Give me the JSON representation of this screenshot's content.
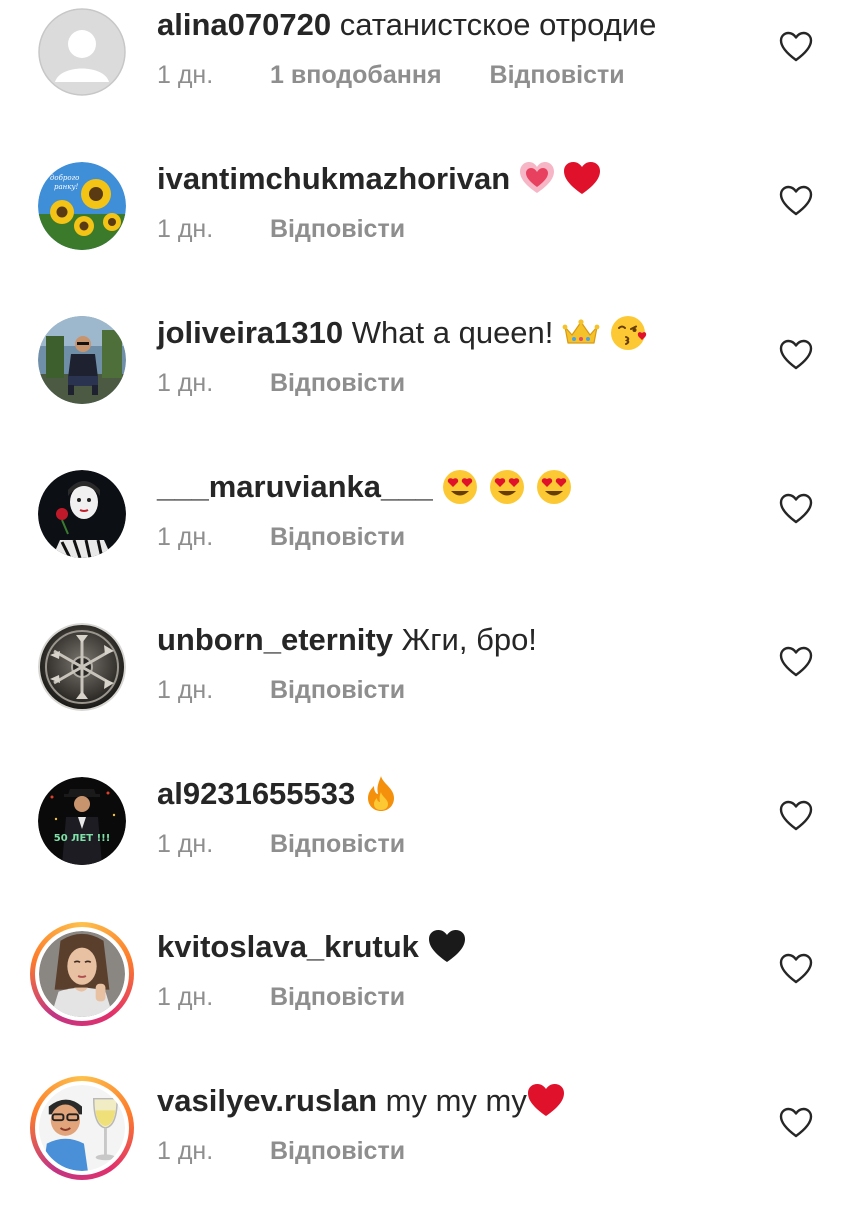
{
  "colors": {
    "text": "#262626",
    "secondary": "#8e8e8e",
    "heart_red": "#e0112b",
    "story_ring": "#e1306c"
  },
  "comments": [
    {
      "username": "alina070720",
      "text": "сатанистское отродие",
      "time": "1 дн.",
      "likes": "1 вподобання",
      "reply": "Відповісти",
      "avatar": "default-avatar-icon"
    },
    {
      "username": "ivantimchukmazhorivan",
      "text": "",
      "emojis": [
        "glowing-heart-emoji",
        "red-heart-emoji"
      ],
      "time": "1 дн.",
      "reply": "Відповісти",
      "avatar": "sunflowers-photo"
    },
    {
      "username": "joliveira1310",
      "text": "What a queen!",
      "emojis": [
        "crown-emoji",
        "kissing-face-emoji"
      ],
      "time": "1 дн.",
      "reply": "Відповісти",
      "avatar": "person-sitting-photo"
    },
    {
      "username": "___maruvianka___",
      "text": "",
      "emojis": [
        "heart-eyes-emoji",
        "heart-eyes-emoji",
        "heart-eyes-emoji"
      ],
      "time": "1 дн.",
      "reply": "Відповісти",
      "avatar": "woman-rose-photo"
    },
    {
      "username": "unborn_eternity",
      "text": "Жги, бро!",
      "time": "1 дн.",
      "reply": "Відповісти",
      "avatar": "axes-emblem-photo"
    },
    {
      "username": "al9231655533",
      "text": "",
      "emojis": [
        "fire-emoji"
      ],
      "time": "1 дн.",
      "reply": "Відповісти",
      "avatar": "man-50-photo",
      "avatar_caption": "50 ЛЕТ !!!"
    },
    {
      "username": "kvitoslava_krutuk",
      "text": "",
      "emojis": [
        "black-heart-emoji"
      ],
      "time": "1 дн.",
      "reply": "Відповісти",
      "avatar": "woman-portrait-photo"
    },
    {
      "username": "vasilyev.ruslan",
      "text": "my my my",
      "emojis": [
        "red-heart-emoji"
      ],
      "time": "1 дн.",
      "reply": "Відповісти",
      "avatar": "bitmoji-wine-photo"
    }
  ]
}
